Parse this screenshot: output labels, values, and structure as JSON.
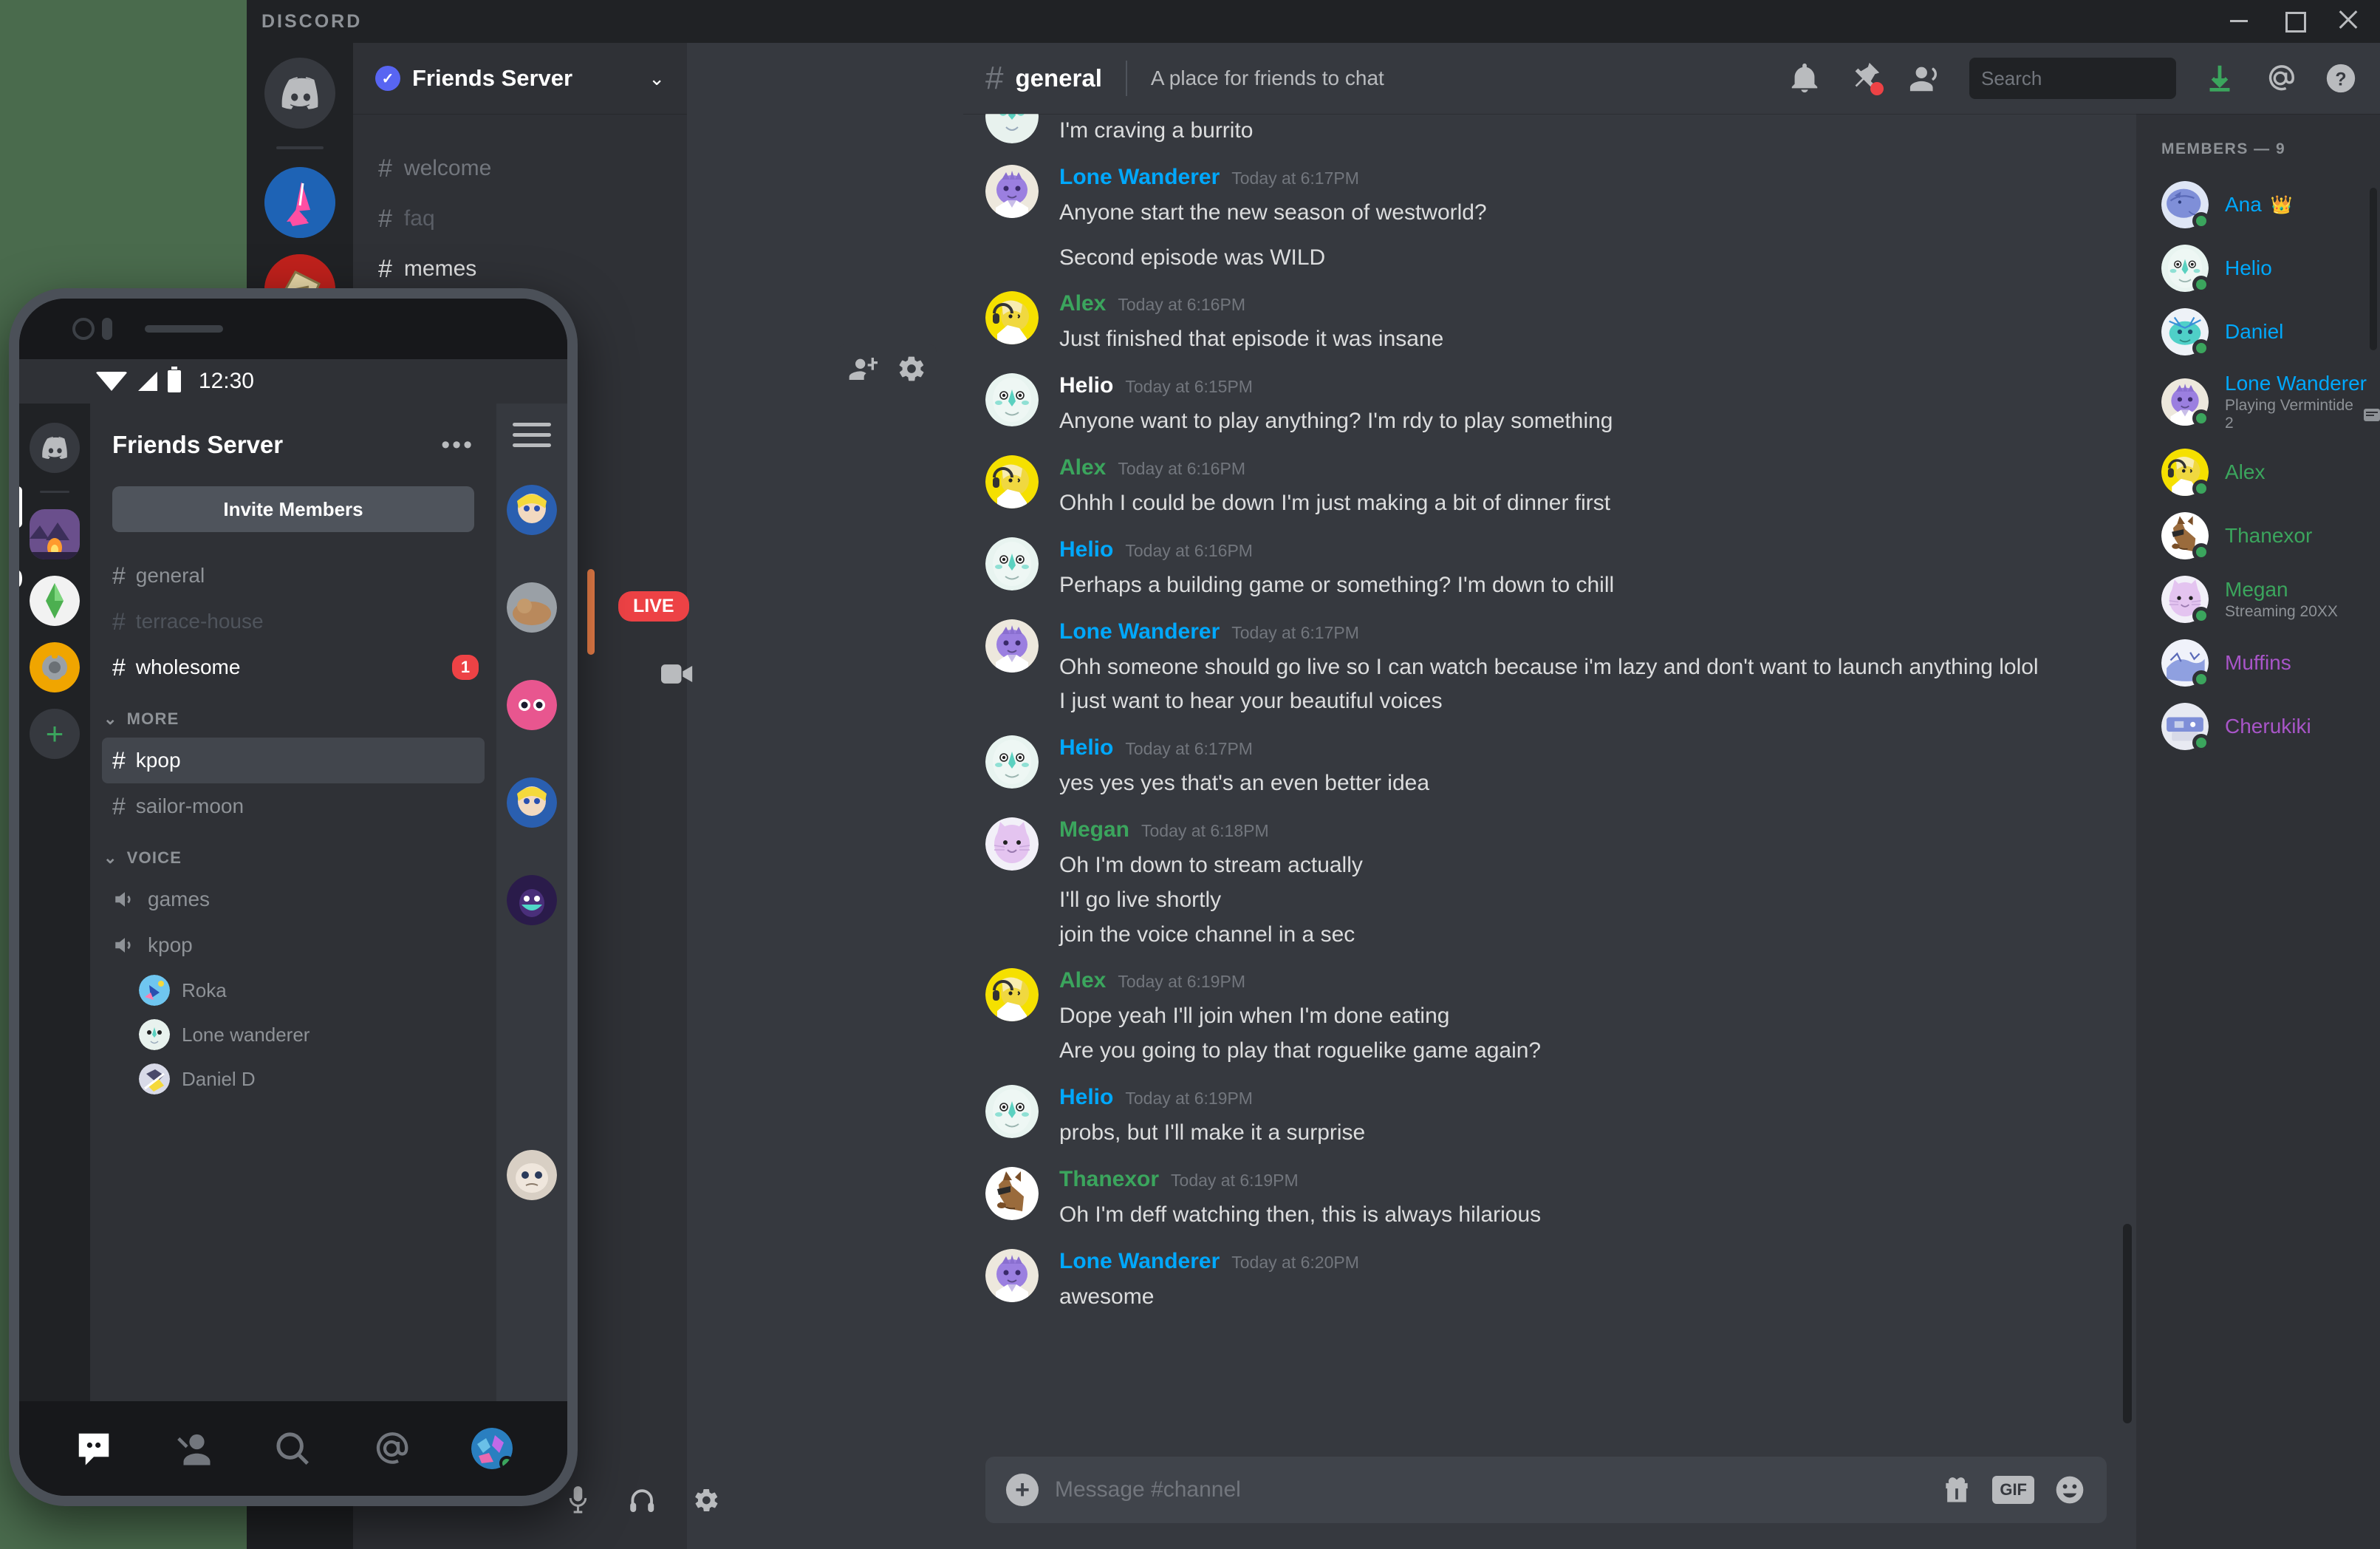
{
  "app": {
    "wordmark": "DISCORD"
  },
  "window_controls": {
    "minimize": "minimize-icon",
    "maximize": "maximize-icon",
    "close": "close-icon"
  },
  "desktop": {
    "server_header": {
      "name": "Friends Server",
      "verified_badge": "verified-check-icon",
      "chevron": "chevron-down-icon"
    },
    "channels": [
      {
        "name": "welcome",
        "state": "normal"
      },
      {
        "name": "faq",
        "state": "muted"
      },
      {
        "name": "memes",
        "state": "active"
      }
    ],
    "sidebar_tools": {
      "add_member": "add-person-icon",
      "settings": "gear-icon"
    }
  },
  "chat": {
    "channel_name": "general",
    "topic": "A place for friends to chat",
    "header_icons": [
      "bell-icon",
      "pin-icon",
      "members-icon",
      "inbox-icon",
      "mention-icon",
      "help-icon"
    ],
    "search": {
      "placeholder": "Search",
      "value": "",
      "icon": "search-icon"
    },
    "composer": {
      "placeholder": "Message #channel",
      "plus": "+",
      "gift_icon": "gift-icon",
      "gif_label": "GIF",
      "emoji_icon": "emoji-icon"
    },
    "partial_top_message": "I'm craving a burrito",
    "messages": [
      {
        "author": "Lone Wanderer",
        "color": "#00a8fc",
        "time": "Today at 6:17PM",
        "avatar": "lone-wanderer",
        "lines": [
          "Anyone start the new season of westworld?",
          "Second episode was WILD"
        ],
        "gap": true
      },
      {
        "author": "Alex",
        "color": "#3ba55d",
        "time": "Today at 6:16PM",
        "avatar": "alex",
        "lines": [
          "Just finished that episode it was insane"
        ]
      },
      {
        "author": "Helio",
        "color": "#ffffff",
        "time": "Today at 6:15PM",
        "avatar": "helio",
        "lines": [
          "Anyone want to play anything? I'm rdy to play something"
        ]
      },
      {
        "author": "Alex",
        "color": "#3ba55d",
        "time": "Today at 6:16PM",
        "avatar": "alex",
        "lines": [
          "Ohhh I could be down I'm just making a bit of dinner first"
        ]
      },
      {
        "author": "Helio",
        "color": "#00a8fc",
        "time": "Today at 6:16PM",
        "avatar": "helio",
        "lines": [
          "Perhaps a building game or something? I'm down to chill"
        ]
      },
      {
        "author": "Lone Wanderer",
        "color": "#00a8fc",
        "time": "Today at 6:17PM",
        "avatar": "lone-wanderer",
        "lines": [
          "Ohh someone should go live so I can watch because i'm lazy and don't want to launch anything lolol",
          "I just want to hear your beautiful voices"
        ]
      },
      {
        "author": "Helio",
        "color": "#00a8fc",
        "time": "Today at 6:17PM",
        "avatar": "helio",
        "lines": [
          "yes yes yes that's an even better idea"
        ]
      },
      {
        "author": "Megan",
        "color": "#3ba55d",
        "time": "Today at 6:18PM",
        "avatar": "megan",
        "lines": [
          "Oh I'm down to stream actually",
          "I'll go live shortly",
          "join the voice channel in a sec"
        ]
      },
      {
        "author": "Alex",
        "color": "#3ba55d",
        "time": "Today at 6:19PM",
        "avatar": "alex",
        "lines": [
          "Dope yeah I'll join when I'm done eating",
          "Are you going to play that roguelike game again?"
        ]
      },
      {
        "author": "Helio",
        "color": "#00a8fc",
        "time": "Today at 6:19PM",
        "avatar": "helio",
        "lines": [
          "probs, but I'll make it a surprise"
        ]
      },
      {
        "author": "Thanexor",
        "color": "#3ba55d",
        "time": "Today at 6:19PM",
        "avatar": "thanexor",
        "lines": [
          "Oh I'm deff watching then, this is always hilarious"
        ]
      },
      {
        "author": "Lone Wanderer",
        "color": "#00a8fc",
        "time": "Today at 6:20PM",
        "avatar": "lone-wanderer",
        "lines": [
          "awesome"
        ]
      }
    ]
  },
  "members_panel": {
    "title": "MEMBERS — 9",
    "members": [
      {
        "name": "Ana",
        "color": "#00a8fc",
        "avatar": "ana",
        "crown": "👑",
        "sub": ""
      },
      {
        "name": "Helio",
        "color": "#00a8fc",
        "avatar": "helio",
        "sub": ""
      },
      {
        "name": "Daniel",
        "color": "#00a8fc",
        "avatar": "daniel",
        "sub": ""
      },
      {
        "name": "Lone Wanderer",
        "color": "#00a8fc",
        "avatar": "lone-wanderer",
        "sub": "Playing Vermintide 2",
        "sub_icon": "activity-icon"
      },
      {
        "name": "Alex",
        "color": "#3ba55d",
        "avatar": "alex",
        "sub": ""
      },
      {
        "name": "Thanexor",
        "color": "#3ba55d",
        "avatar": "thanexor",
        "sub": ""
      },
      {
        "name": "Megan",
        "color": "#3ba55d",
        "avatar": "megan",
        "sub": "Streaming 20XX"
      },
      {
        "name": "Muffins",
        "color": "#a855c8",
        "avatar": "muffins",
        "sub": ""
      },
      {
        "name": "Cherukiki",
        "color": "#a855c8",
        "avatar": "cherukiki",
        "sub": ""
      }
    ]
  },
  "phone": {
    "status_bar": {
      "time": "12:30",
      "wifi": "wifi-icon",
      "signal": "signal-icon",
      "battery": "battery-icon"
    },
    "server_name": "Friends Server",
    "more_menu": "•••",
    "invite_button": "Invite Members",
    "channels": [
      {
        "name": "general",
        "state": "normal"
      },
      {
        "name": "terrace-house",
        "state": "dim"
      },
      {
        "name": "wholesome",
        "state": "active",
        "badge": "1"
      }
    ],
    "more_category": "MORE",
    "more_channels": [
      {
        "name": "kpop",
        "state": "selected"
      },
      {
        "name": "sailor-moon",
        "state": "normal"
      }
    ],
    "voice_category": "VOICE",
    "voice_channels": [
      {
        "name": "games",
        "users": []
      },
      {
        "name": "kpop",
        "users": [
          {
            "name": "Roka",
            "avatar": "roka"
          },
          {
            "name": "Lone wanderer",
            "avatar": "helio"
          },
          {
            "name": "Daniel D",
            "avatar": "daniel"
          }
        ]
      }
    ],
    "bottom_nav": [
      "discord-home-icon",
      "friends-icon",
      "search-icon",
      "mentions-icon",
      "profile-avatar"
    ],
    "voice_controls": [
      "microphone-icon",
      "headphones-icon",
      "gear-icon"
    ]
  },
  "overlay": {
    "live_badge": "LIVE",
    "camera_icon": "camera-icon"
  }
}
